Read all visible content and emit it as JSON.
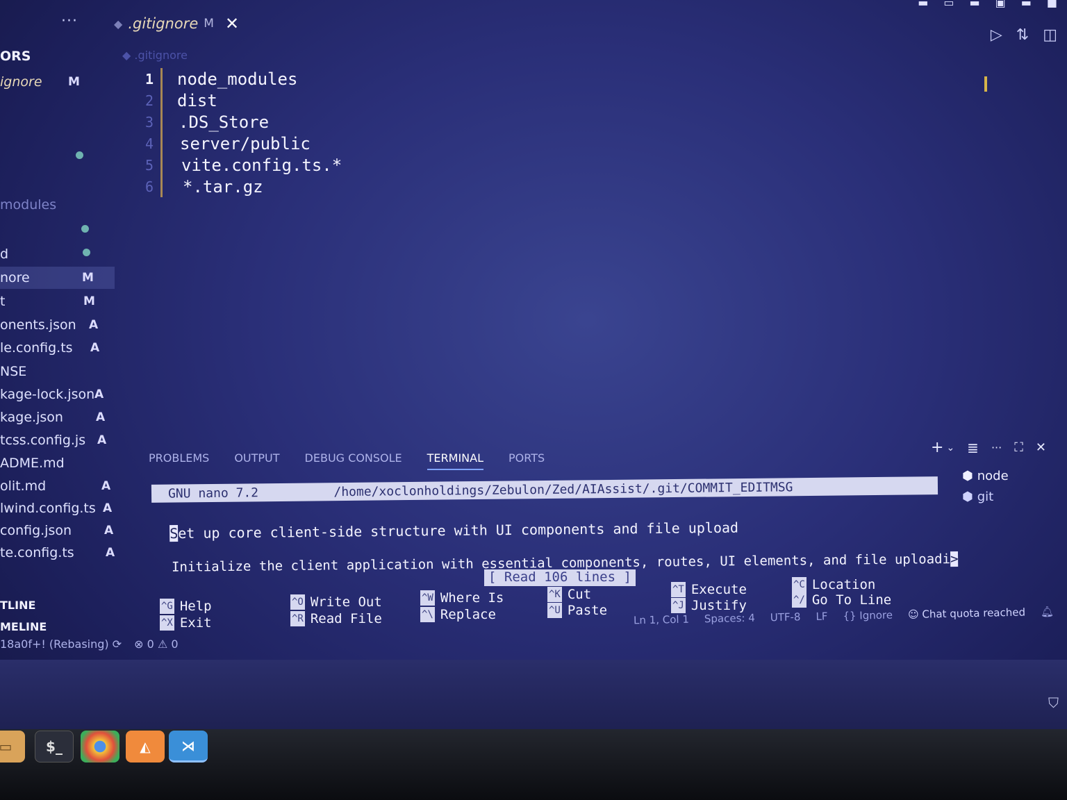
{
  "tabbar": {
    "more": "···",
    "tab": {
      "name": ".gitignore",
      "modified": "M",
      "close": "✕"
    },
    "actions": [
      "▷",
      "⇅",
      "◫"
    ]
  },
  "sidebar": {
    "head": "ORS",
    "open_file": {
      "name": "ignore",
      "status": "M"
    },
    "folder": "modules",
    "items": [
      {
        "name": "d",
        "status": ""
      },
      {
        "name": "nore",
        "status": "M"
      },
      {
        "name": "t",
        "status": "M"
      },
      {
        "name": "onents.json",
        "status": "A"
      },
      {
        "name": "le.config.ts",
        "status": "A"
      },
      {
        "name": "NSE",
        "status": ""
      },
      {
        "name": "kage-lock.json",
        "status": "A"
      },
      {
        "name": "kage.json",
        "status": "A"
      },
      {
        "name": "tcss.config.js",
        "status": "A"
      },
      {
        "name": "ADME.md",
        "status": ""
      },
      {
        "name": "olit.md",
        "status": "A"
      },
      {
        "name": "lwind.config.ts",
        "status": "A"
      },
      {
        "name": "config.json",
        "status": "A"
      },
      {
        "name": "te.config.ts",
        "status": "A"
      }
    ],
    "outline": "TLINE",
    "timeline": "MELINE"
  },
  "editor": {
    "breadcrumb": ".gitignore",
    "lines": [
      {
        "num": "1",
        "text": "node_modules"
      },
      {
        "num": "2",
        "text": "dist"
      },
      {
        "num": "3",
        "text": ".DS_Store"
      },
      {
        "num": "4",
        "text": "server/public"
      },
      {
        "num": "5",
        "text": "vite.config.ts.*"
      },
      {
        "num": "6",
        "text": "*.tar.gz"
      }
    ]
  },
  "panel": {
    "tabs": [
      "PROBLEMS",
      "OUTPUT",
      "DEBUG CONSOLE",
      "TERMINAL",
      "PORTS"
    ],
    "active_tab": "TERMINAL",
    "actions": [
      "+",
      "⌄",
      "≣",
      "···",
      "⛶",
      "✕"
    ],
    "terminals": [
      {
        "name": "node"
      },
      {
        "name": "git"
      }
    ]
  },
  "nano": {
    "header": "GNU nano 7.2          /home/xoclonholdings/Zebulon/Zed/AIAssist/.git/COMMIT_EDITMSG",
    "line1_cursor": "S",
    "line1_rest": "et up core client-side structure with UI components and file upload",
    "line2": "Initialize the client application with essential components, routes, UI elements, and file uploadi",
    "line2_more": ">",
    "message": "[ Read 106 lines ]",
    "shortcuts": [
      {
        "key": "^G",
        "label": "Help"
      },
      {
        "key": "^X",
        "label": "Exit"
      },
      {
        "key": "^O",
        "label": "Write Out"
      },
      {
        "key": "^R",
        "label": "Read File"
      },
      {
        "key": "^W",
        "label": "Where Is"
      },
      {
        "key": "^\\",
        "label": "Replace"
      },
      {
        "key": "^K",
        "label": "Cut"
      },
      {
        "key": "^U",
        "label": "Paste"
      },
      {
        "key": "^T",
        "label": "Execute"
      },
      {
        "key": "^J",
        "label": "Justify"
      },
      {
        "key": "^C",
        "label": "Location"
      },
      {
        "key": "^/",
        "label": "Go To Line"
      }
    ]
  },
  "statusbar": {
    "branch": "18a0f+! (Rebasing)",
    "errors": "0",
    "warnings": "0",
    "position": "Ln 1, Col 1",
    "spaces": "Spaces: 4",
    "encoding": "UTF-8",
    "eol": "LF",
    "language": "{} Ignore",
    "quota": "Chat quota reached"
  },
  "taskbar": {
    "apps": [
      "files",
      "terminal",
      "chrome",
      "brave",
      "vscode"
    ]
  }
}
